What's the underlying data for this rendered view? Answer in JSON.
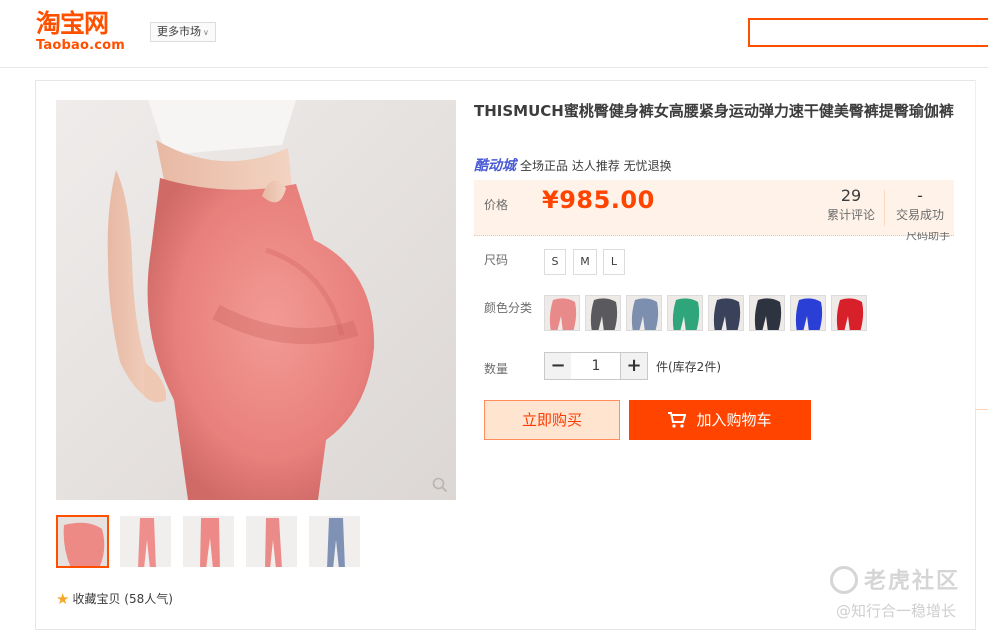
{
  "header": {
    "logo_cn": "淘宝网",
    "logo_en": "Taobao.com",
    "market_label": "更多市场",
    "market_icon": "chevron-down-icon",
    "search_placeholder": ""
  },
  "product": {
    "title": "THISMUCH蜜桃臀健身裤女高腰紧身运动弹力速干健美臀裤提臀瑜伽裤",
    "brand_logo": "酷动城",
    "brand_tags": "全场正品 达人推荐 无忧退换",
    "price_label": "价格",
    "price": "¥985.00",
    "reviews_count": "29",
    "reviews_label": "累计评论",
    "deals_count": "-",
    "deals_label": "交易成功",
    "size_help": "尺码助手",
    "size_label": "尺码",
    "sizes": [
      "S",
      "M",
      "L"
    ],
    "color_label": "颜色分类",
    "color_swatches": [
      "#e98a8a",
      "#5a5a5e",
      "#7d8fae",
      "#2fa57c",
      "#39425a",
      "#2e3340",
      "#2a3fd6",
      "#d8202a"
    ],
    "qty_label": "数量",
    "qty_value": "1",
    "qty_minus": "−",
    "qty_plus": "+",
    "stock_text": "件(库存2件)",
    "buy_now": "立即购买",
    "add_cart": "加入购物车",
    "favorite": "收藏宝贝 (58人气)"
  },
  "gallery": {
    "thumb_colors": [
      "#ee8a86",
      "#ef8f8d",
      "#ed8a88",
      "#ea8b89",
      "#7f92b5"
    ],
    "selected_index": 0
  },
  "watermark": {
    "line1": "老虎社区",
    "line2": "@知行合一稳增长"
  },
  "colors": {
    "brand": "#ff5000",
    "price": "#ff4400"
  }
}
